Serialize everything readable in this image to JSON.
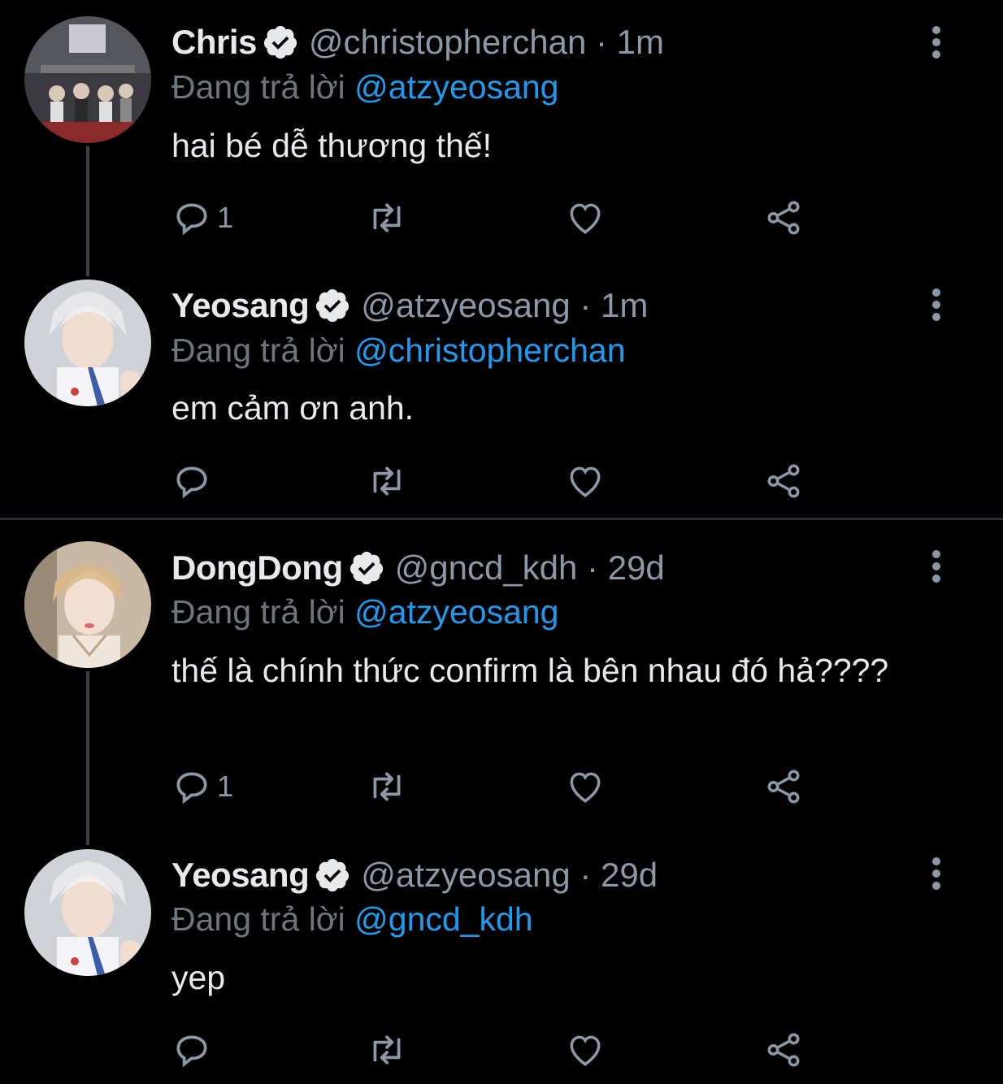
{
  "colors": {
    "background": "#000000",
    "accent": "#1d9bf0",
    "muted": "#8b98a5",
    "text": "#e7e9ea"
  },
  "tweets": [
    {
      "name": "Chris",
      "handle": "@christopherchan · 1m",
      "reply_prefix": "Đang trả lời",
      "reply_to": "@atzyeosang",
      "body": "hai bé dễ thương thế!",
      "reply_count": "1",
      "avatar_icon": "avatar-chris"
    },
    {
      "name": "Yeosang",
      "handle": "@atzyeosang · 1m",
      "reply_prefix": "Đang trả lời",
      "reply_to": "@christopherchan",
      "body": "em cảm ơn anh.",
      "reply_count": "",
      "avatar_icon": "avatar-yeosang"
    },
    {
      "name": "DongDong",
      "handle": "@gncd_kdh · 29d",
      "reply_prefix": "Đang trả lời",
      "reply_to": "@atzyeosang",
      "body": "thế là chính thức confirm là bên nhau đó hả????",
      "reply_count": "1",
      "avatar_icon": "avatar-dongdong"
    },
    {
      "name": "Yeosang",
      "handle": "@atzyeosang · 29d",
      "reply_prefix": "Đang trả lời",
      "reply_to": "@gncd_kdh",
      "body": "yep",
      "reply_count": "",
      "avatar_icon": "avatar-yeosang"
    }
  ]
}
